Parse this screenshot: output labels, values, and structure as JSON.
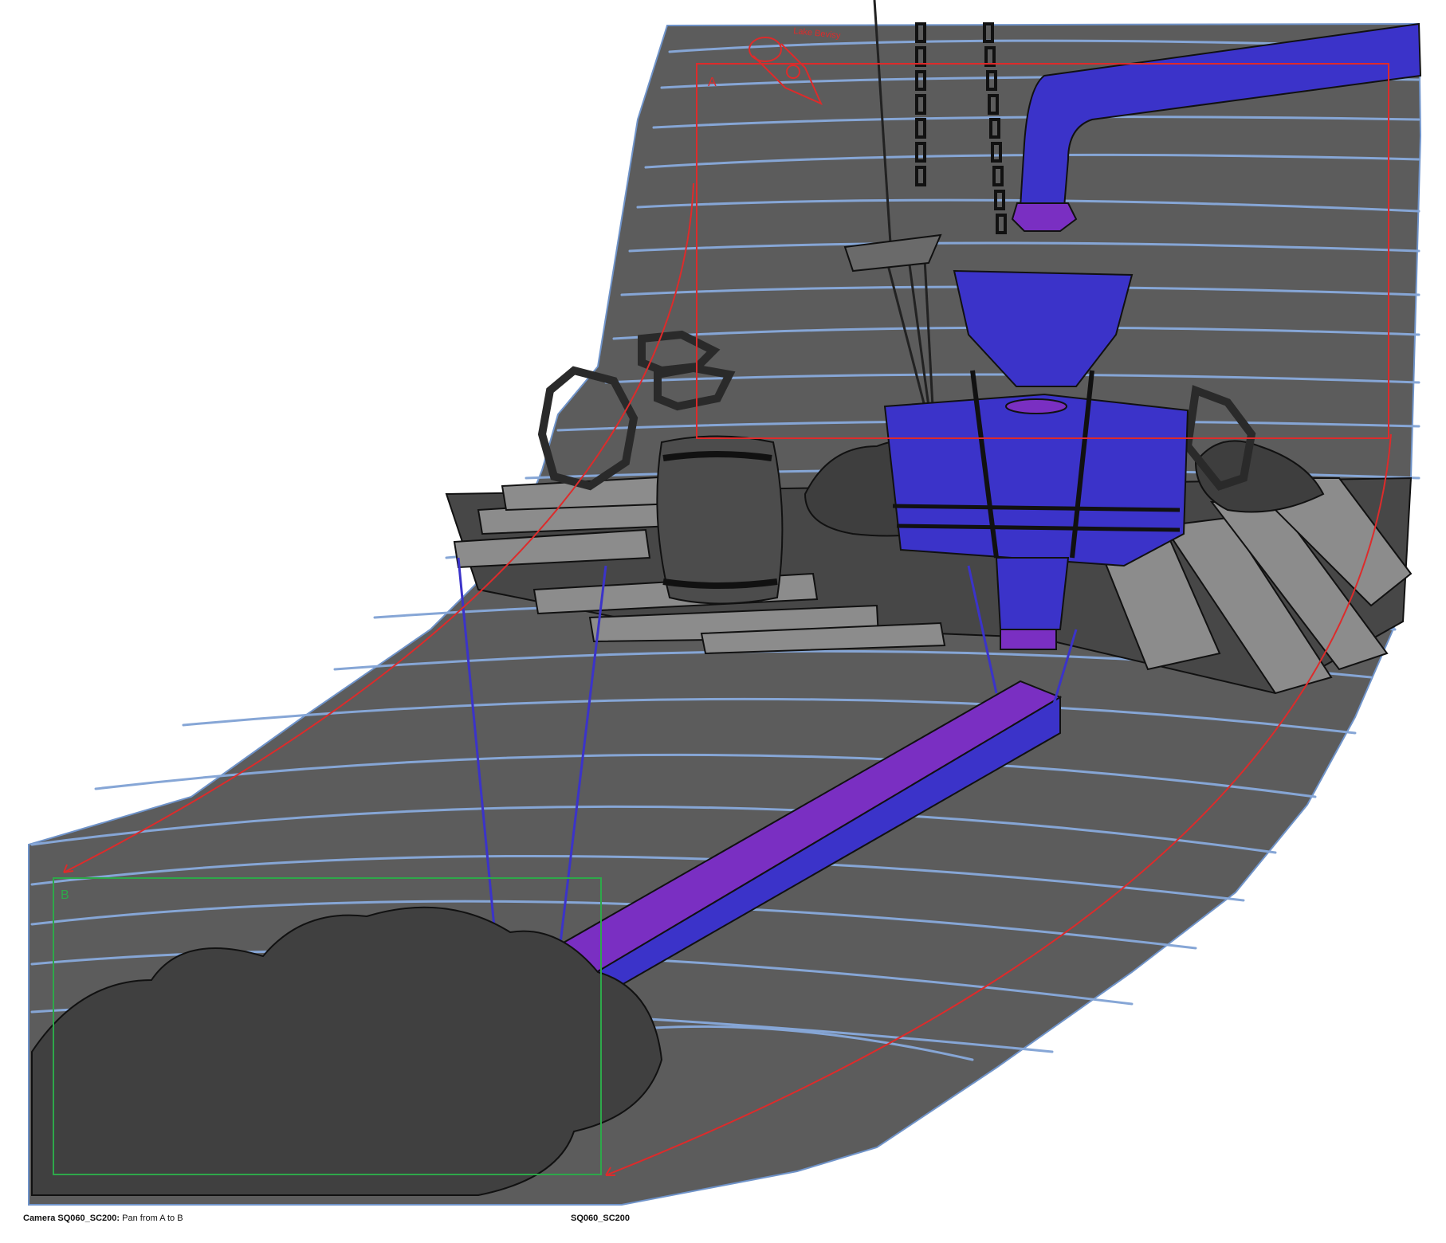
{
  "caption": {
    "camera_label": "Camera SQ060_SC200:",
    "camera_note": " Pan from A to B",
    "scene_id": "SQ060_SC200"
  },
  "frames": {
    "start_label": "A",
    "end_label": "B"
  },
  "annotation": {
    "handwritten_note": "Lake Bevisy"
  },
  "colors": {
    "background": "#ffffff",
    "backdrop": "#5c5c5c",
    "backdrop_edge": "#6f93c9",
    "wave_lines": "#86a6d6",
    "ground": "#444444",
    "planks": "#8c8c8c",
    "props_grey": "#4a4a4a",
    "highlight_blue": "#3b33c9",
    "highlight_purple": "#7a2fc2",
    "frame_a": "#dd2b2b",
    "frame_b": "#2ea84a",
    "ink": "#111111"
  }
}
